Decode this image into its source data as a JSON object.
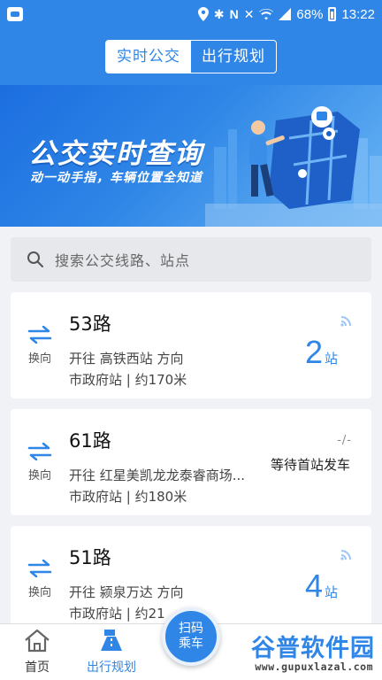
{
  "status_bar": {
    "battery": "68%",
    "time": "13:22",
    "icons": [
      "app-icon",
      "location-icon",
      "bluetooth-icon",
      "nfc-icon",
      "mute-icon",
      "wifi-icon",
      "signal-icon",
      "battery-icon"
    ]
  },
  "header": {
    "tabs": [
      {
        "label": "实时公交",
        "active": true
      },
      {
        "label": "出行规划",
        "active": false
      }
    ]
  },
  "banner": {
    "title": "公交实时查询",
    "subtitle": "动一动手指，车辆位置全知道"
  },
  "search": {
    "placeholder": "搜索公交线路、站点"
  },
  "routes": [
    {
      "swap_label": "换向",
      "name": "53路",
      "direction": "开往 高铁西站 方向",
      "stop": "市政府站 | 约170米",
      "eta_num": "2",
      "eta_unit": "站"
    },
    {
      "swap_label": "换向",
      "name": "61路",
      "direction": "开往 红星美凯龙龙泰睿商场...",
      "stop": "市政府站 | 约180米",
      "status": "等待首站发车",
      "dash": "-/-"
    },
    {
      "swap_label": "换向",
      "name": "51路",
      "direction": "开往 颍泉万达 方向",
      "stop": "市政府站 | 约21",
      "eta_num": "4",
      "eta_unit": "站"
    }
  ],
  "bottom_nav": {
    "home_label": "首页",
    "plan_label": "出行规划",
    "scan_line1": "扫码",
    "scan_line2": "乘车"
  },
  "watermark": {
    "big": "谷普软件园",
    "small": "www.gupuxlazal.com"
  },
  "colors": {
    "brand": "#2f86e6",
    "background": "#f0f2f5",
    "card": "#ffffff"
  }
}
